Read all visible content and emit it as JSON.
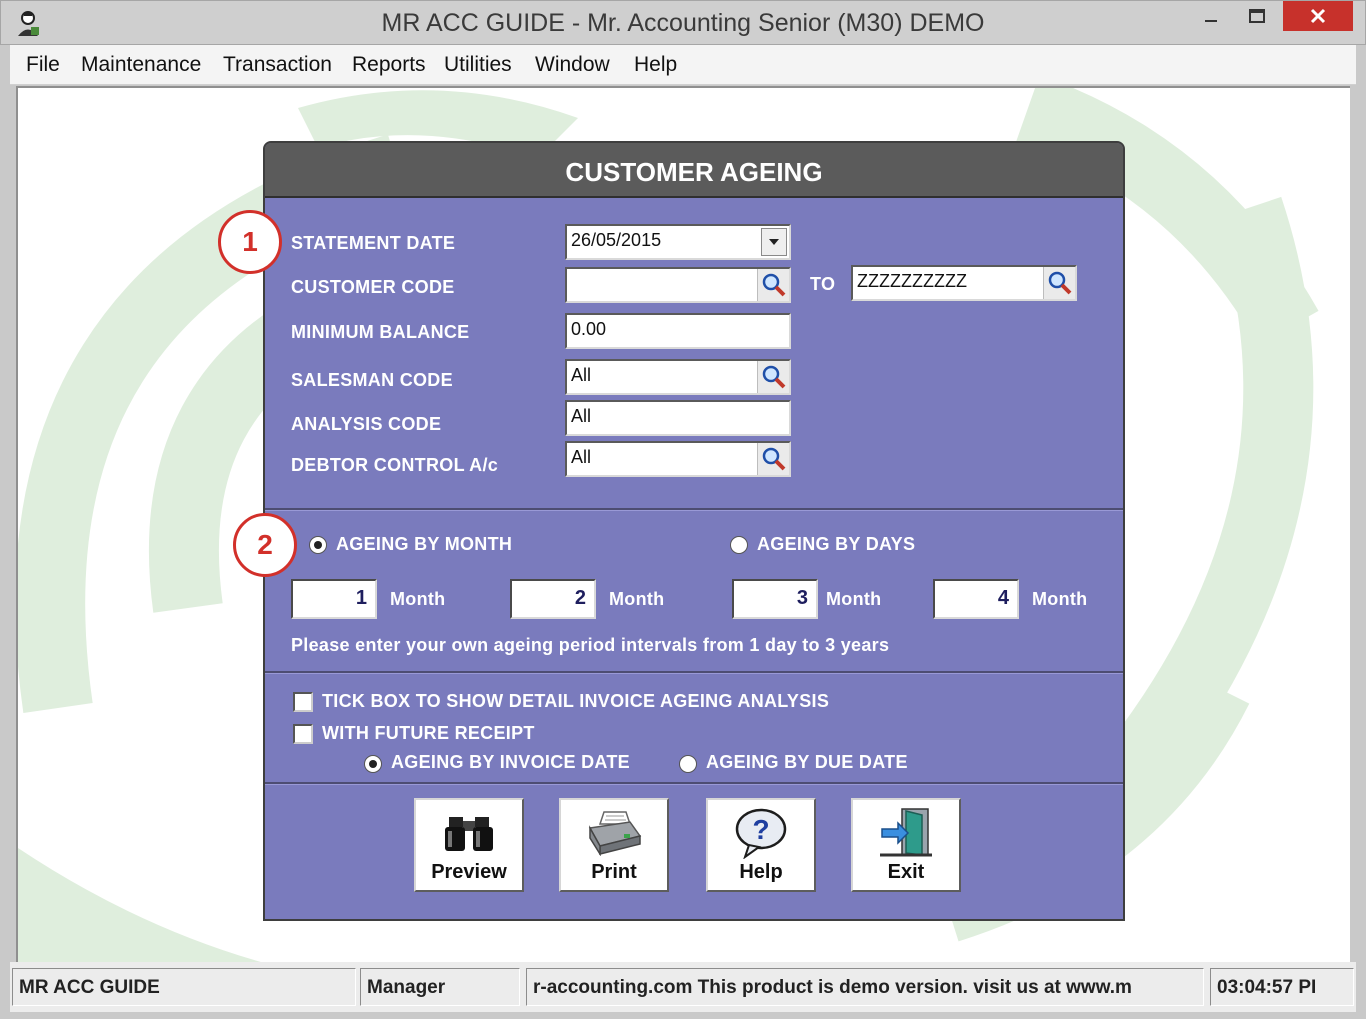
{
  "window": {
    "title": "MR ACC GUIDE - Mr. Accounting Senior (M30) DEMO",
    "controls": {
      "minimize": "–",
      "maximize": "□",
      "close": "✕"
    }
  },
  "menu": [
    "File",
    "Maintenance",
    "Transaction",
    "Reports",
    "Utilities",
    "Window",
    "Help"
  ],
  "dialog": {
    "title": "CUSTOMER AGEING",
    "callouts": [
      "1",
      "2"
    ],
    "fields": {
      "statement_date": {
        "label": "STATEMENT DATE",
        "value": "26/05/2015"
      },
      "customer_code": {
        "label": "CUSTOMER CODE",
        "from_value": "",
        "to_label": "TO",
        "to_value": "ZZZZZZZZZZ"
      },
      "minimum_balance": {
        "label": "MINIMUM BALANCE",
        "value": "0.00"
      },
      "salesman_code": {
        "label": "SALESMAN CODE",
        "value": "All"
      },
      "analysis_code": {
        "label": "ANALYSIS CODE",
        "value": "All"
      },
      "debtor_control": {
        "label": "DEBTOR CONTROL A/c",
        "value": "All"
      }
    },
    "ageing": {
      "by_month_label": "AGEING BY MONTH",
      "by_days_label": "AGEING BY DAYS",
      "selected": "month",
      "periods": [
        {
          "value": "1",
          "unit": "Month"
        },
        {
          "value": "2",
          "unit": "Month"
        },
        {
          "value": "3",
          "unit": "Month"
        },
        {
          "value": "4",
          "unit": "Month"
        }
      ],
      "hint": "Please enter your own ageing period intervals from 1 day to 3 years"
    },
    "options": {
      "detail_invoice_label": "TICK BOX TO SHOW DETAIL INVOICE AGEING ANALYSIS",
      "detail_invoice_checked": false,
      "future_receipt_label": "WITH FUTURE RECEIPT",
      "future_receipt_checked": false,
      "by_invoice_date_label": "AGEING BY INVOICE DATE",
      "by_due_date_label": "AGEING BY DUE DATE",
      "date_basis_selected": "invoice"
    },
    "buttons": {
      "preview": "Preview",
      "print": "Print",
      "help": "Help",
      "exit": "Exit"
    }
  },
  "statusbar": {
    "app": "MR ACC GUIDE",
    "user": "Manager",
    "message": "r-accounting.com This product is demo version.  visit us at www.m",
    "time": "03:04:57 PI"
  },
  "colors": {
    "dialog_bg": "#7a7bbd",
    "dialog_header": "#5b5b5b",
    "callout_red": "#d2302a",
    "close_red": "#c7312b",
    "watermark_green": "#dfeedd"
  }
}
